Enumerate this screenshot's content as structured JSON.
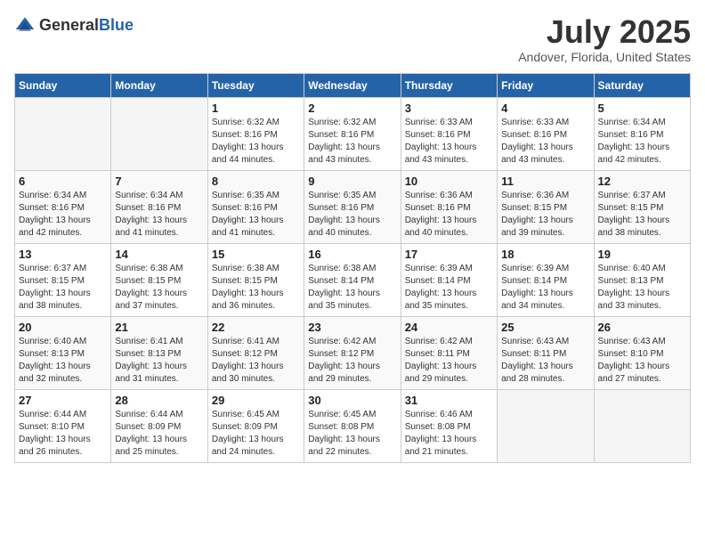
{
  "logo": {
    "general": "General",
    "blue": "Blue"
  },
  "title": "July 2025",
  "subtitle": "Andover, Florida, United States",
  "weekdays": [
    "Sunday",
    "Monday",
    "Tuesday",
    "Wednesday",
    "Thursday",
    "Friday",
    "Saturday"
  ],
  "weeks": [
    [
      {
        "day": "",
        "sunrise": "",
        "sunset": "",
        "daylight": ""
      },
      {
        "day": "",
        "sunrise": "",
        "sunset": "",
        "daylight": ""
      },
      {
        "day": "1",
        "sunrise": "Sunrise: 6:32 AM",
        "sunset": "Sunset: 8:16 PM",
        "daylight": "Daylight: 13 hours and 44 minutes."
      },
      {
        "day": "2",
        "sunrise": "Sunrise: 6:32 AM",
        "sunset": "Sunset: 8:16 PM",
        "daylight": "Daylight: 13 hours and 43 minutes."
      },
      {
        "day": "3",
        "sunrise": "Sunrise: 6:33 AM",
        "sunset": "Sunset: 8:16 PM",
        "daylight": "Daylight: 13 hours and 43 minutes."
      },
      {
        "day": "4",
        "sunrise": "Sunrise: 6:33 AM",
        "sunset": "Sunset: 8:16 PM",
        "daylight": "Daylight: 13 hours and 43 minutes."
      },
      {
        "day": "5",
        "sunrise": "Sunrise: 6:34 AM",
        "sunset": "Sunset: 8:16 PM",
        "daylight": "Daylight: 13 hours and 42 minutes."
      }
    ],
    [
      {
        "day": "6",
        "sunrise": "Sunrise: 6:34 AM",
        "sunset": "Sunset: 8:16 PM",
        "daylight": "Daylight: 13 hours and 42 minutes."
      },
      {
        "day": "7",
        "sunrise": "Sunrise: 6:34 AM",
        "sunset": "Sunset: 8:16 PM",
        "daylight": "Daylight: 13 hours and 41 minutes."
      },
      {
        "day": "8",
        "sunrise": "Sunrise: 6:35 AM",
        "sunset": "Sunset: 8:16 PM",
        "daylight": "Daylight: 13 hours and 41 minutes."
      },
      {
        "day": "9",
        "sunrise": "Sunrise: 6:35 AM",
        "sunset": "Sunset: 8:16 PM",
        "daylight": "Daylight: 13 hours and 40 minutes."
      },
      {
        "day": "10",
        "sunrise": "Sunrise: 6:36 AM",
        "sunset": "Sunset: 8:16 PM",
        "daylight": "Daylight: 13 hours and 40 minutes."
      },
      {
        "day": "11",
        "sunrise": "Sunrise: 6:36 AM",
        "sunset": "Sunset: 8:15 PM",
        "daylight": "Daylight: 13 hours and 39 minutes."
      },
      {
        "day": "12",
        "sunrise": "Sunrise: 6:37 AM",
        "sunset": "Sunset: 8:15 PM",
        "daylight": "Daylight: 13 hours and 38 minutes."
      }
    ],
    [
      {
        "day": "13",
        "sunrise": "Sunrise: 6:37 AM",
        "sunset": "Sunset: 8:15 PM",
        "daylight": "Daylight: 13 hours and 38 minutes."
      },
      {
        "day": "14",
        "sunrise": "Sunrise: 6:38 AM",
        "sunset": "Sunset: 8:15 PM",
        "daylight": "Daylight: 13 hours and 37 minutes."
      },
      {
        "day": "15",
        "sunrise": "Sunrise: 6:38 AM",
        "sunset": "Sunset: 8:15 PM",
        "daylight": "Daylight: 13 hours and 36 minutes."
      },
      {
        "day": "16",
        "sunrise": "Sunrise: 6:38 AM",
        "sunset": "Sunset: 8:14 PM",
        "daylight": "Daylight: 13 hours and 35 minutes."
      },
      {
        "day": "17",
        "sunrise": "Sunrise: 6:39 AM",
        "sunset": "Sunset: 8:14 PM",
        "daylight": "Daylight: 13 hours and 35 minutes."
      },
      {
        "day": "18",
        "sunrise": "Sunrise: 6:39 AM",
        "sunset": "Sunset: 8:14 PM",
        "daylight": "Daylight: 13 hours and 34 minutes."
      },
      {
        "day": "19",
        "sunrise": "Sunrise: 6:40 AM",
        "sunset": "Sunset: 8:13 PM",
        "daylight": "Daylight: 13 hours and 33 minutes."
      }
    ],
    [
      {
        "day": "20",
        "sunrise": "Sunrise: 6:40 AM",
        "sunset": "Sunset: 8:13 PM",
        "daylight": "Daylight: 13 hours and 32 minutes."
      },
      {
        "day": "21",
        "sunrise": "Sunrise: 6:41 AM",
        "sunset": "Sunset: 8:13 PM",
        "daylight": "Daylight: 13 hours and 31 minutes."
      },
      {
        "day": "22",
        "sunrise": "Sunrise: 6:41 AM",
        "sunset": "Sunset: 8:12 PM",
        "daylight": "Daylight: 13 hours and 30 minutes."
      },
      {
        "day": "23",
        "sunrise": "Sunrise: 6:42 AM",
        "sunset": "Sunset: 8:12 PM",
        "daylight": "Daylight: 13 hours and 29 minutes."
      },
      {
        "day": "24",
        "sunrise": "Sunrise: 6:42 AM",
        "sunset": "Sunset: 8:11 PM",
        "daylight": "Daylight: 13 hours and 29 minutes."
      },
      {
        "day": "25",
        "sunrise": "Sunrise: 6:43 AM",
        "sunset": "Sunset: 8:11 PM",
        "daylight": "Daylight: 13 hours and 28 minutes."
      },
      {
        "day": "26",
        "sunrise": "Sunrise: 6:43 AM",
        "sunset": "Sunset: 8:10 PM",
        "daylight": "Daylight: 13 hours and 27 minutes."
      }
    ],
    [
      {
        "day": "27",
        "sunrise": "Sunrise: 6:44 AM",
        "sunset": "Sunset: 8:10 PM",
        "daylight": "Daylight: 13 hours and 26 minutes."
      },
      {
        "day": "28",
        "sunrise": "Sunrise: 6:44 AM",
        "sunset": "Sunset: 8:09 PM",
        "daylight": "Daylight: 13 hours and 25 minutes."
      },
      {
        "day": "29",
        "sunrise": "Sunrise: 6:45 AM",
        "sunset": "Sunset: 8:09 PM",
        "daylight": "Daylight: 13 hours and 24 minutes."
      },
      {
        "day": "30",
        "sunrise": "Sunrise: 6:45 AM",
        "sunset": "Sunset: 8:08 PM",
        "daylight": "Daylight: 13 hours and 22 minutes."
      },
      {
        "day": "31",
        "sunrise": "Sunrise: 6:46 AM",
        "sunset": "Sunset: 8:08 PM",
        "daylight": "Daylight: 13 hours and 21 minutes."
      },
      {
        "day": "",
        "sunrise": "",
        "sunset": "",
        "daylight": ""
      },
      {
        "day": "",
        "sunrise": "",
        "sunset": "",
        "daylight": ""
      }
    ]
  ]
}
